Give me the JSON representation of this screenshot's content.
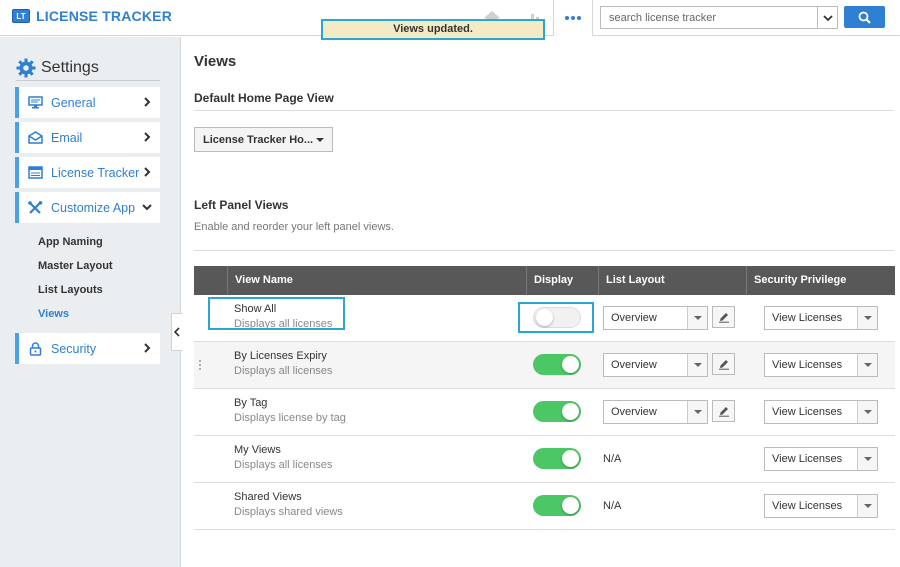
{
  "app": {
    "logo_badge": "LT",
    "title": "LICENSE TRACKER"
  },
  "toast": "Views updated.",
  "search": {
    "placeholder": "search license tracker"
  },
  "sidebar": {
    "heading": "Settings",
    "items": [
      {
        "label": "General",
        "icon": "monitor-icon"
      },
      {
        "label": "Email",
        "icon": "envelope-icon"
      },
      {
        "label": "License Tracker",
        "icon": "list-window-icon"
      },
      {
        "label": "Customize App",
        "icon": "tools-icon",
        "expanded": true
      },
      {
        "label": "Security",
        "icon": "lock-icon"
      }
    ],
    "subitems": [
      {
        "label": "App Naming",
        "active": false
      },
      {
        "label": "Master Layout",
        "active": false
      },
      {
        "label": "List Layouts",
        "active": false
      },
      {
        "label": "Views",
        "active": true
      }
    ]
  },
  "main": {
    "title": "Views",
    "default_home": {
      "heading": "Default Home Page View",
      "selected": "License Tracker Ho..."
    },
    "left_panel": {
      "heading": "Left Panel Views",
      "description": "Enable and reorder your left panel views."
    },
    "table": {
      "columns": [
        "View Name",
        "Display",
        "List Layout",
        "Security Privilege"
      ],
      "rows": [
        {
          "name": "Show All",
          "desc": "Displays all licenses",
          "display": false,
          "layout": "Overview",
          "editable": true,
          "privilege": "View Licenses"
        },
        {
          "name": "By Licenses Expiry",
          "desc": "Displays all licenses",
          "display": true,
          "layout": "Overview",
          "editable": true,
          "privilege": "View Licenses"
        },
        {
          "name": "By Tag",
          "desc": "Displays license by tag",
          "display": true,
          "layout": "Overview",
          "editable": true,
          "privilege": "View Licenses"
        },
        {
          "name": "My Views",
          "desc": "Displays all licenses",
          "display": true,
          "layout": "N/A",
          "editable": false,
          "privilege": "View Licenses"
        },
        {
          "name": "Shared Views",
          "desc": "Displays shared views",
          "display": true,
          "layout": "N/A",
          "editable": false,
          "privilege": "View Licenses"
        }
      ]
    }
  },
  "colors": {
    "accent": "#2f7fd2",
    "toggle_on": "#4cc765",
    "highlight": "#2aa6d6",
    "toast_bg": "#f3ebc5"
  }
}
